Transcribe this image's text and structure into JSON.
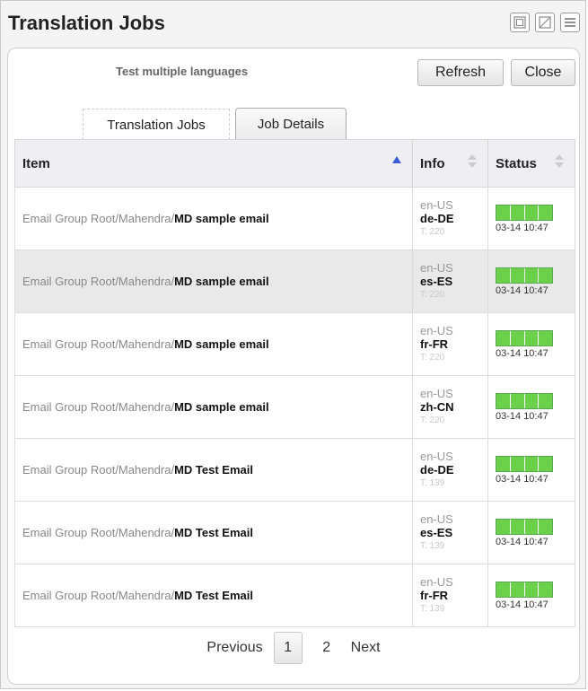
{
  "window": {
    "title": "Translation Jobs",
    "icons": [
      "restore-icon",
      "fullscreen-icon",
      "menu-icon"
    ]
  },
  "panel": {
    "subtitle": "Test multiple languages",
    "buttons": {
      "refresh": "Refresh",
      "close": "Close"
    },
    "tabs": [
      {
        "label": "Translation Jobs"
      },
      {
        "label": "Job Details"
      }
    ]
  },
  "table": {
    "headers": {
      "item": "Item",
      "info": "Info",
      "status": "Status"
    },
    "rows": [
      {
        "path": "Email Group Root/Mahendra/",
        "name": "MD sample email",
        "src": "en-US",
        "tgt": "de-DE",
        "t": "T: 220",
        "time": "03-14 10:47",
        "progress": 1.0
      },
      {
        "path": "Email Group Root/Mahendra/",
        "name": "MD sample email",
        "src": "en-US",
        "tgt": "es-ES",
        "t": "T: 220",
        "time": "03-14 10:47",
        "progress": 1.0
      },
      {
        "path": "Email Group Root/Mahendra/",
        "name": "MD sample email",
        "src": "en-US",
        "tgt": "fr-FR",
        "t": "T: 220",
        "time": "03-14 10:47",
        "progress": 1.0
      },
      {
        "path": "Email Group Root/Mahendra/",
        "name": "MD sample email",
        "src": "en-US",
        "tgt": "zh-CN",
        "t": "T: 220",
        "time": "03-14 10:47",
        "progress": 1.0
      },
      {
        "path": "Email Group Root/Mahendra/",
        "name": "MD Test Email",
        "src": "en-US",
        "tgt": "de-DE",
        "t": "T: 139",
        "time": "03-14 10:47",
        "progress": 1.0
      },
      {
        "path": "Email Group Root/Mahendra/",
        "name": "MD Test Email",
        "src": "en-US",
        "tgt": "es-ES",
        "t": "T: 139",
        "time": "03-14 10:47",
        "progress": 1.0
      },
      {
        "path": "Email Group Root/Mahendra/",
        "name": "MD Test Email",
        "src": "en-US",
        "tgt": "fr-FR",
        "t": "T: 139",
        "time": "03-14 10:47",
        "progress": 1.0
      }
    ]
  },
  "pagination": {
    "previous": "Previous",
    "pages": [
      "1",
      "2"
    ],
    "current": "1",
    "next": "Next"
  },
  "colors": {
    "progress_fill": "#6bd14b",
    "sort_active": "#3d5bd6"
  }
}
